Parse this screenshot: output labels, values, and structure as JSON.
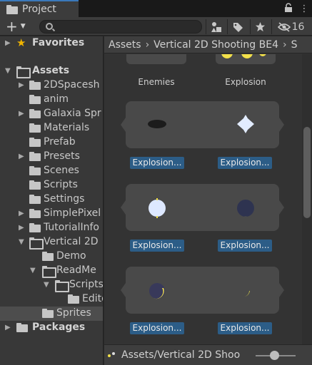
{
  "window": {
    "tab_label": "Project"
  },
  "toolbar": {
    "create_label": "+",
    "search": {
      "value": "",
      "placeholder": ""
    },
    "hidden_count": "16"
  },
  "tree": {
    "favorites": "Favorites",
    "assets": "Assets",
    "items": [
      "2DSpacesh",
      "anim",
      "Galaxia Spr",
      "Materials",
      "Prefab",
      "Presets",
      "Scenes",
      "Scripts",
      "Settings",
      "SimplePixel",
      "TutorialInfo",
      "Vertical 2D"
    ],
    "vertical_children": [
      "Demo",
      "ReadMe"
    ],
    "readme_children": [
      "Scripts"
    ],
    "scripts_children": [
      "Edito"
    ],
    "selected": "Sprites",
    "packages": "Packages"
  },
  "breadcrumb": [
    "Assets",
    "Vertical 2D Shooting BE4",
    "S"
  ],
  "grid": {
    "top_row": [
      "Enemies",
      "Explosion"
    ],
    "sprite_captions": [
      "Explosion...",
      "Explosion...",
      "Explosion...",
      "Explosion...",
      "Explosion...",
      "Explosion..."
    ]
  },
  "footer": {
    "path": "Assets/Vertical 2D Shoo"
  },
  "colors": {
    "selection": "#2c5d87",
    "accent": "#3a79bb",
    "sprite_yellow": "#f2e04a"
  }
}
